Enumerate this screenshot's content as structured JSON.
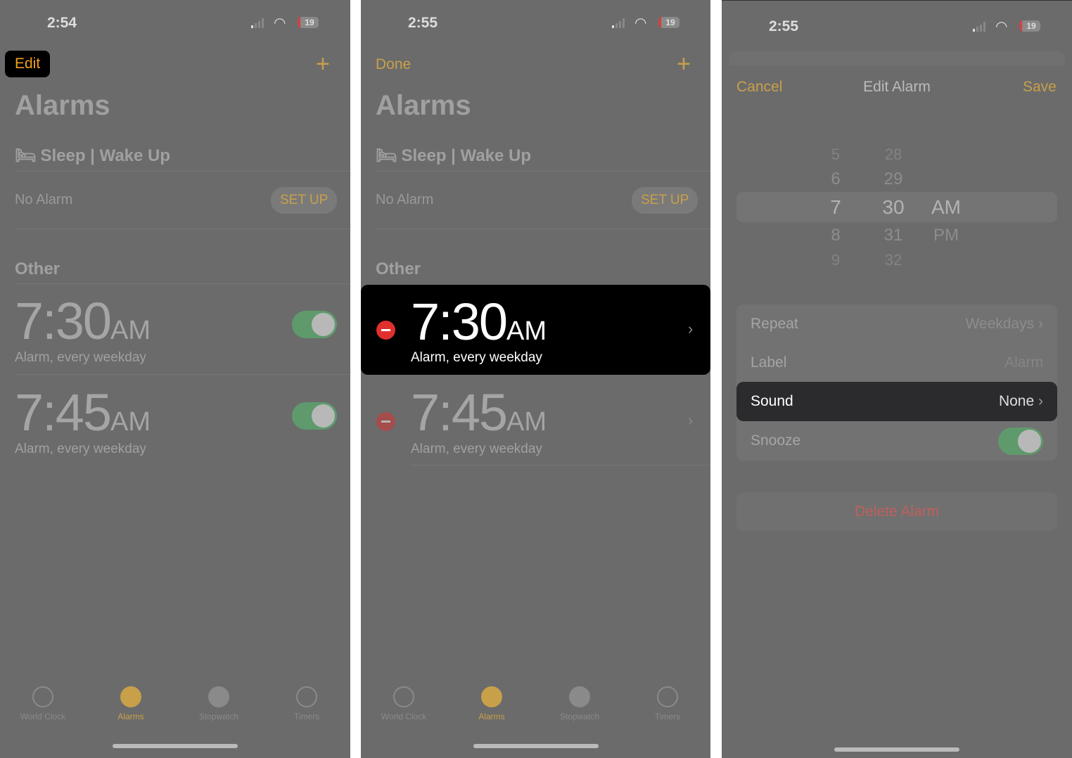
{
  "colors": {
    "accent": "#c9a04a",
    "toggle_on": "#5f9a6c",
    "delete_red": "#e0302e",
    "panel_bg": "#6b6b6b"
  },
  "screen1": {
    "status_time": "2:54",
    "battery": "19",
    "edit": "Edit",
    "title": "Alarms",
    "sleep_section": "Sleep | Wake Up",
    "no_alarm": "No Alarm",
    "setup": "SET UP",
    "other": "Other",
    "alarms": [
      {
        "time": "7:30",
        "ampm": "AM",
        "label": "Alarm, every weekday",
        "enabled": true
      },
      {
        "time": "7:45",
        "ampm": "AM",
        "label": "Alarm, every weekday",
        "enabled": true
      }
    ]
  },
  "screen2": {
    "status_time": "2:55",
    "battery": "19",
    "done": "Done",
    "title": "Alarms",
    "sleep_section": "Sleep | Wake Up",
    "no_alarm": "No Alarm",
    "setup": "SET UP",
    "other": "Other",
    "alarms": [
      {
        "time": "7:30",
        "ampm": "AM",
        "label": "Alarm, every weekday"
      },
      {
        "time": "7:45",
        "ampm": "AM",
        "label": "Alarm, every weekday"
      }
    ]
  },
  "tabs": [
    {
      "label": "World Clock",
      "icon": "globe-icon"
    },
    {
      "label": "Alarms",
      "icon": "alarm-clock-icon",
      "active": true
    },
    {
      "label": "Stopwatch",
      "icon": "stopwatch-icon"
    },
    {
      "label": "Timers",
      "icon": "timer-icon"
    }
  ],
  "screen3": {
    "status_time": "2:55",
    "battery": "19",
    "cancel": "Cancel",
    "title": "Edit Alarm",
    "save": "Save",
    "picker": {
      "hours": [
        "5",
        "6",
        "7",
        "8",
        "9"
      ],
      "minutes": [
        "28",
        "29",
        "30",
        "31",
        "32"
      ],
      "periods": [
        "AM",
        "PM"
      ],
      "selected": {
        "hour": "7",
        "minute": "30",
        "period": "AM"
      }
    },
    "repeat_label": "Repeat",
    "repeat_value": "Weekdays",
    "label_label": "Label",
    "label_value": "Alarm",
    "sound_label": "Sound",
    "sound_value": "None",
    "snooze_label": "Snooze",
    "snooze_on": true,
    "delete": "Delete Alarm"
  }
}
